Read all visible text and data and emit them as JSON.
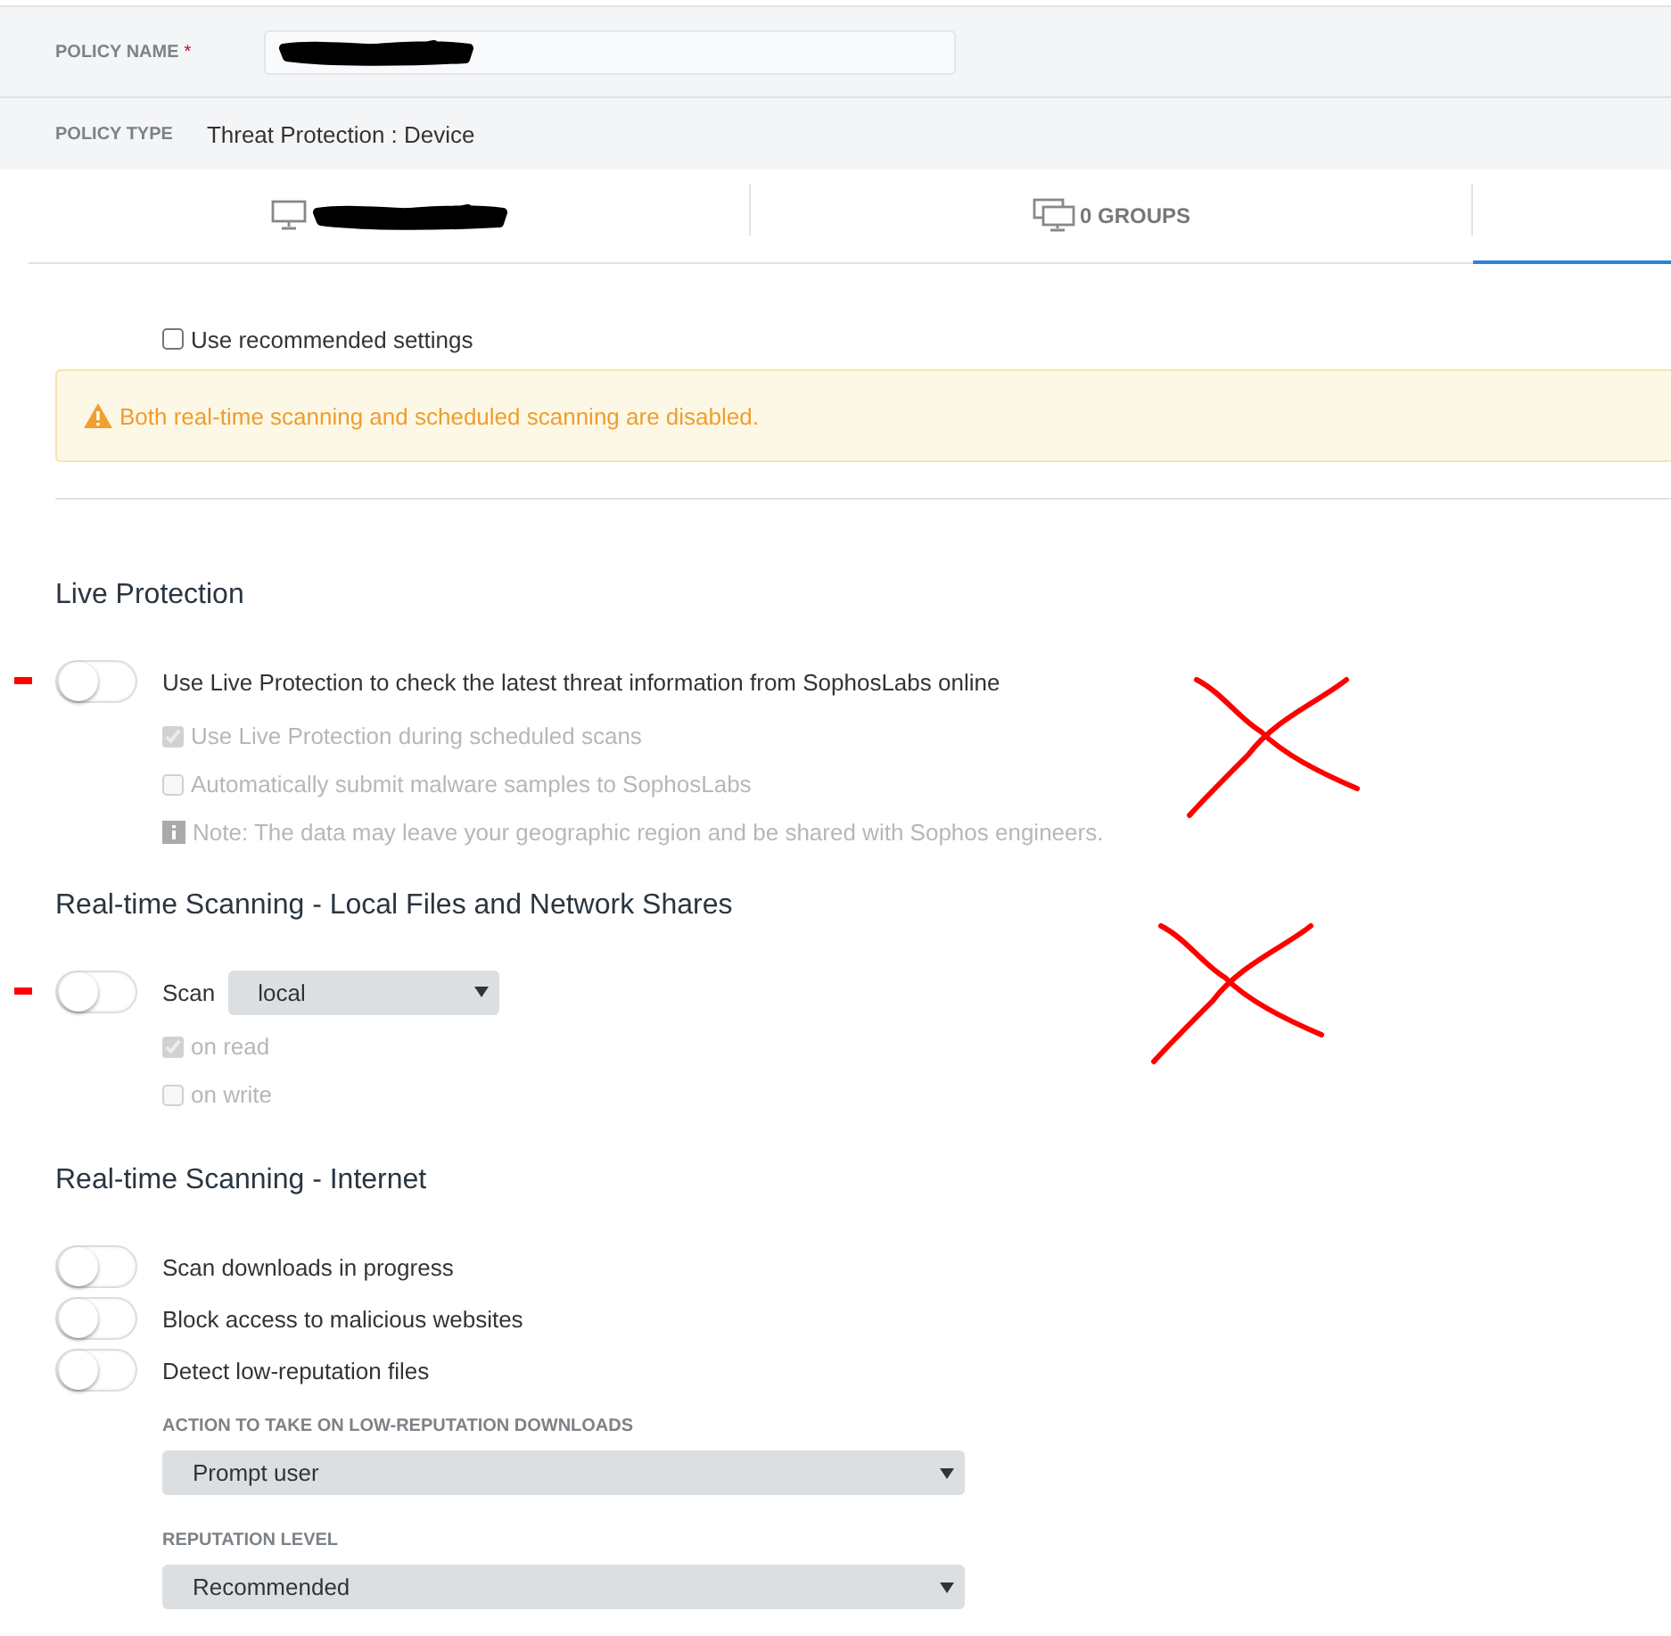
{
  "policy_name": {
    "label": "POLICY NAME",
    "required_mark": "*",
    "redacted": true
  },
  "policy_type": {
    "label": "POLICY TYPE",
    "value": "Threat Protection : Device"
  },
  "tabs": [
    {
      "kind": "devices",
      "redacted": true,
      "selected": false
    },
    {
      "kind": "groups",
      "label": "0 GROUPS",
      "selected": false
    },
    {
      "kind": "blank",
      "selected": true
    }
  ],
  "recommended": {
    "label": "Use recommended settings",
    "checked": false
  },
  "warning": {
    "text": "Both real-time scanning and scheduled scanning are disabled."
  },
  "sections": [
    {
      "title": "Live Protection",
      "crossed": true,
      "items": [
        {
          "kind": "toggle",
          "label": "Use Live Protection to check the latest threat information from SophosLabs online",
          "on": false,
          "marked": true
        },
        {
          "kind": "checkbox",
          "label": "Use Live Protection during scheduled scans",
          "checked": true,
          "disabled": true
        },
        {
          "kind": "checkbox",
          "label": "Automatically submit malware samples to SophosLabs",
          "checked": false,
          "disabled": true
        },
        {
          "kind": "note",
          "text": "Note: The data may leave your geographic region and be shared with Sophos engineers."
        }
      ]
    },
    {
      "title": "Real-time Scanning - Local Files and Network Shares",
      "crossed": true,
      "items": [
        {
          "kind": "toggle-select",
          "label": "Scan",
          "value": "local",
          "on": false,
          "marked": true
        },
        {
          "kind": "checkbox",
          "label": "on read",
          "checked": true,
          "disabled": true
        },
        {
          "kind": "checkbox",
          "label": "on write",
          "checked": false,
          "disabled": true
        }
      ]
    },
    {
      "title": "Real-time Scanning - Internet",
      "crossed": false,
      "items": [
        {
          "kind": "toggle",
          "label": "Scan downloads in progress",
          "on": false,
          "marked": false
        },
        {
          "kind": "toggle",
          "label": "Block access to malicious websites",
          "on": false,
          "marked": false
        },
        {
          "kind": "toggle",
          "label": "Detect low-reputation files",
          "on": false,
          "marked": false
        },
        {
          "kind": "select",
          "label": "ACTION TO TAKE ON LOW-REPUTATION DOWNLOADS",
          "value": "Prompt user"
        },
        {
          "kind": "select",
          "label": "REPUTATION LEVEL",
          "value": "Recommended"
        }
      ]
    }
  ]
}
